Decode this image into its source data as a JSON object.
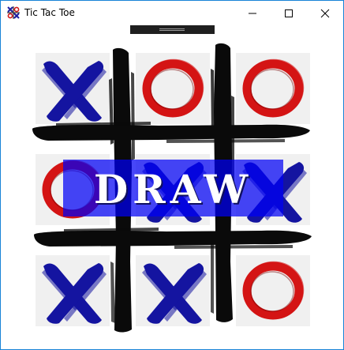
{
  "window": {
    "title": "Tic Tac Toe",
    "icon": "tic-tac-toe-app-icon",
    "controls": [
      "minimize-icon",
      "maximize-icon",
      "close-icon"
    ]
  },
  "board": {
    "cells": [
      [
        "X",
        "O",
        "O"
      ],
      [
        "O",
        "X",
        "X"
      ],
      [
        "X",
        "X",
        "O"
      ]
    ]
  },
  "result": {
    "banner_text": "DRAW"
  },
  "colors": {
    "x_mark": "#1414a0",
    "o_mark": "#d41414",
    "grid_lines": "#0a0a0a",
    "banner": "#0000f5",
    "cell_bg": "#f0f0f0",
    "window_border": "#1883d7"
  }
}
